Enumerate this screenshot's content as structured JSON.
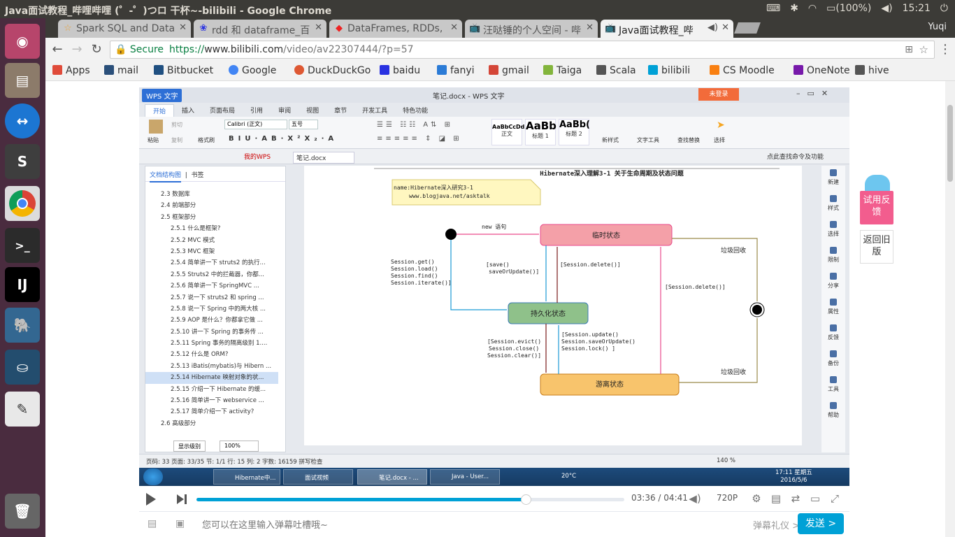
{
  "os": {
    "window_title": "Java面试教程_哔哩哔哩 (゜-゜)つロ 干杯~-bilibili - Google Chrome",
    "tray": {
      "battery": "(100%)",
      "time": "15:21"
    }
  },
  "launcher": {
    "items": [
      "Ubuntu dash",
      "Files",
      "TeamViewer",
      "Slack",
      "Chrome",
      "Terminal",
      "IntelliJ IDEA",
      "pgAdmin",
      "MySQL Workbench",
      "Text Editor",
      "Trash"
    ]
  },
  "browser": {
    "tabs": [
      {
        "label": "Spark SQL and Data",
        "icon": "star"
      },
      {
        "label": "rdd 和 dataframe_百",
        "icon": "paw"
      },
      {
        "label": "DataFrames, RDDs,",
        "icon": "stack"
      },
      {
        "label": "汪哒锤的个人空间 - 哔",
        "icon": "tv"
      },
      {
        "label": "Java面试教程_哔",
        "icon": "tv"
      }
    ],
    "profile": "Yuqi",
    "secure": "Secure",
    "url_scheme": "https://",
    "url_host": "www.bilibili.com",
    "url_path": "/video/av22307444/?p=57",
    "bookmarks": [
      {
        "label": "Apps",
        "color": "#e04b3a"
      },
      {
        "label": "mail",
        "color": "#2a4f7a"
      },
      {
        "label": "Bitbucket",
        "color": "#205081"
      },
      {
        "label": "Google",
        "color": "#4285f4"
      },
      {
        "label": "DuckDuckGo",
        "color": "#de5833"
      },
      {
        "label": "baidu",
        "color": "#2932e1"
      },
      {
        "label": "fanyi",
        "color": "#2b7bd6"
      },
      {
        "label": "gmail",
        "color": "#d44638"
      },
      {
        "label": "Taiga",
        "color": "#83b53c"
      },
      {
        "label": "Scala",
        "color": "#555555"
      },
      {
        "label": "bilibili",
        "color": "#00a1d6"
      },
      {
        "label": "CS Moodle",
        "color": "#f98012"
      },
      {
        "label": "OneNote",
        "color": "#7719aa"
      },
      {
        "label": "hive",
        "color": "#555555"
      }
    ]
  },
  "wps": {
    "app_name": "WPS 文字",
    "doc_title": "笔记.docx - WPS 文字",
    "login": "未登录",
    "menu_tabs": [
      "开始",
      "插入",
      "页面布局",
      "引用",
      "审阅",
      "视图",
      "章节",
      "开发工具",
      "特色功能"
    ],
    "font": "Calibri (正文)",
    "size": "五号",
    "paste": "粘贴",
    "cut": "剪切",
    "copy": "复制",
    "format_painter": "格式刷",
    "styles": [
      {
        "preview": "AaBbCcDd",
        "name": "正文"
      },
      {
        "preview": "AaBb",
        "name": "标题 1"
      },
      {
        "preview": "AaBb(",
        "name": "标题 2"
      }
    ],
    "new_style": "新样式",
    "text_tools": "文字工具",
    "find_replace": "查找替换",
    "select": "选择",
    "doc_tabs": [
      "我的WPS",
      "笔记.docx"
    ],
    "search_hint": "点此查找命令及功能",
    "outline_tabs": [
      "文档结构图",
      "书签"
    ],
    "outline_items": [
      "2.3 数据库",
      "2.4 前端部分",
      "2.5 框架部分",
      "2.5.1 什么是框架?",
      "2.5.2 MVC 模式",
      "2.5.3 MVC 框架",
      "2.5.4 简单讲一下 struts2 的执行...",
      "2.5.5 Struts2 中的拦截器，你都...",
      "2.5.6 简单讲一下 SpringMVC ...",
      "2.5.7 说一下 struts2 和 spring ...",
      "2.5.8 说一下 Spring 中的两大核 ...",
      "2.5.9 AOP 是什么？你都拿它做 ...",
      "2.5.10 讲一下 Spring 的事务传 ...",
      "2.5.11 Spring 事务的隔离级别 1....",
      "2.5.12 什么是 ORM?",
      "2.5.13 iBatis(mybatis)与 Hibern ...",
      "2.5.14 Hibernate 映射对象的状...",
      "2.5.15 介绍一下 Hibernate 的缓...",
      "2.5.16 简单讲一下 webservice ...",
      "2.5.17 简单介绍一下 activity?",
      "2.6 高级部分"
    ],
    "outline_level": "显示级别",
    "zoom_select": "100%",
    "diagram": {
      "title": "Hibernate深入理解3-1 关于生命周期及状态问题",
      "note_line1": "name:Hibernate深入研究3-1",
      "note_line2": "www.blogjava.net/asktalk",
      "state_transient": "临时状态",
      "state_persistent": "持久化状态",
      "state_detached": "游离状态",
      "new_label": "new 语句",
      "gc1": "垃圾回收",
      "gc2": "垃圾回收",
      "save_label": "[save()",
      "save_label2": "saveOrUpdate()]",
      "delete_label": "[Session.delete()]",
      "delete_label2": "[Session.delete()]",
      "get_labels": [
        "Session.get()",
        "Session.load()",
        "Session.find()",
        "Session.iterate()]"
      ],
      "evict_labels": [
        "[Session.evict()",
        "Session.close()",
        "Session.clear()]"
      ],
      "update_labels": [
        "[Session.update()",
        "Session.saveOrUpdate()",
        "Session.lock()        ]"
      ]
    },
    "right_tools": [
      "新建",
      "样式",
      "选择",
      "限制",
      "分享",
      "属性",
      "反馈",
      "备份",
      "工具",
      "帮助"
    ],
    "status": "页码: 33  页面: 33/35  节: 1/1  行: 15  列: 2  字数: 16159  拼写检查",
    "zoom": "140 %"
  },
  "windows_taskbar": {
    "buttons": [
      "Hibernate中...",
      "面试视频",
      "笔记.docx - ...",
      "Java - User..."
    ],
    "clock_time": "17:11 星期五",
    "clock_date": "2016/5/6",
    "temp": "20°C"
  },
  "player": {
    "current_time": "03:36",
    "separator": "/",
    "duration": "04:41",
    "progress": 0.77,
    "quality": "720P",
    "danmaku_placeholder": "您可以在这里输入弹幕吐槽哦~",
    "gift": "弹幕礼仪 >",
    "send": "发送 >"
  },
  "side": {
    "feedback": "试用反馈",
    "back_old": "返回旧版"
  }
}
